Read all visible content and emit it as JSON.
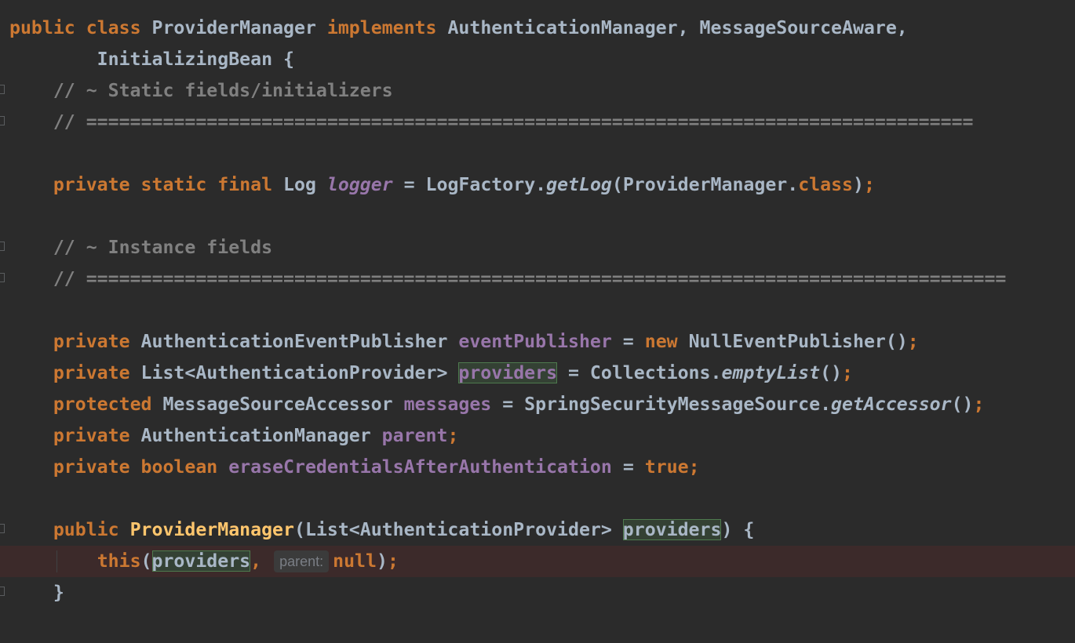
{
  "editor": {
    "language": "java",
    "theme": "darcula",
    "error_line_color": "#3c2a2a",
    "usage_highlight_color": "#344134",
    "param_hint": {
      "label": "parent:"
    },
    "lines": {
      "l1": {
        "t1": "public",
        "t2": " ",
        "t3": "class",
        "t4": " ProviderManager ",
        "t5": "implements",
        "t6": " AuthenticationManager, MessageSourceAware,"
      },
      "l2": {
        "t1": "        InitializingBean {"
      },
      "l3": {
        "t1": "    // ~ Static fields/initializers"
      },
      "l4": {
        "t1": "    // ================================================================================="
      },
      "l5": {
        "t1": "    ",
        "t2": "private",
        "t3": " ",
        "t4": "static",
        "t5": " ",
        "t6": "final",
        "t7": " Log ",
        "t8": "logger",
        "t9": " = LogFactory.",
        "t10": "getLog",
        "t11": "(ProviderManager.",
        "t12": "class",
        "t13": ")",
        "t14": ";"
      },
      "l6": {
        "t1": "    // ~ Instance fields"
      },
      "l7": {
        "t1": "    // ===================================================================================="
      },
      "l8": {
        "t1": "    ",
        "t2": "private",
        "t3": " AuthenticationEventPublisher ",
        "t4": "eventPublisher",
        "t5": " = ",
        "t6": "new",
        "t7": " NullEventPublisher()",
        "t8": ";"
      },
      "l9": {
        "t1": "    ",
        "t2": "private",
        "t3": " List<AuthenticationProvider> ",
        "t4": "providers",
        "t5": " = Collections.",
        "t6": "emptyList",
        "t7": "()",
        "t8": ";"
      },
      "l10": {
        "t1": "    ",
        "t2": "protected",
        "t3": " MessageSourceAccessor ",
        "t4": "messages",
        "t5": " = SpringSecurityMessageSource.",
        "t6": "getAccessor",
        "t7": "()",
        "t8": ";"
      },
      "l11": {
        "t1": "    ",
        "t2": "private",
        "t3": " AuthenticationManager ",
        "t4": "parent",
        "t5": ";"
      },
      "l12": {
        "t1": "    ",
        "t2": "private",
        "t3": " ",
        "t4": "boolean",
        "t5": " ",
        "t6": "eraseCredentialsAfterAuthentication",
        "t7": " = ",
        "t8": "true",
        "t9": ";"
      },
      "l13": {
        "t1": "    ",
        "t2": "public",
        "t3": " ",
        "t4": "ProviderManager",
        "t5": "(List<AuthenticationProvider> ",
        "t6": "providers",
        "t7": ") {"
      },
      "l14": {
        "t1": "        ",
        "t2": "this",
        "t3": "(",
        "t4": "providers",
        "t5": ",",
        "t6": " ",
        "t7": "null",
        "t8": ")",
        "t9": ";"
      },
      "l15": {
        "t1": "    }"
      }
    }
  }
}
